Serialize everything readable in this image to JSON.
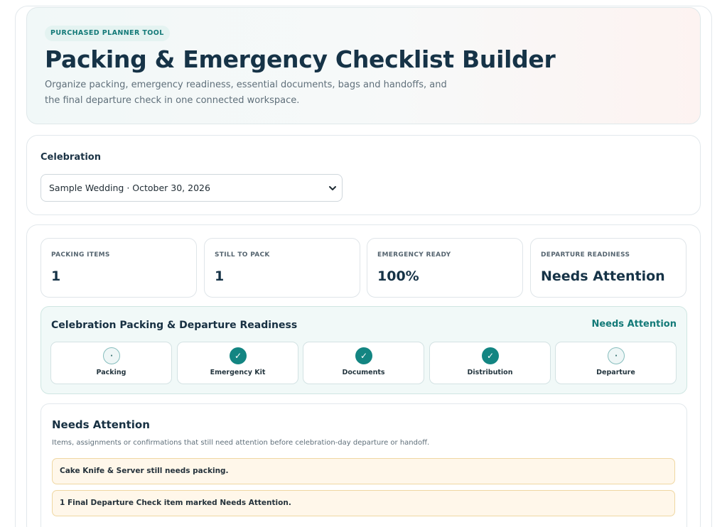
{
  "hero": {
    "badge": "PURCHASED PLANNER TOOL",
    "title": "Packing & Emergency Checklist Builder",
    "subtitle": "Organize packing, emergency readiness, essential documents, bags and handoffs, and the final departure check in one connected workspace."
  },
  "selector": {
    "label": "Celebration",
    "value": "Sample Wedding · October 30, 2026"
  },
  "stats": [
    {
      "label": "PACKING ITEMS",
      "value": "1"
    },
    {
      "label": "STILL TO PACK",
      "value": "1"
    },
    {
      "label": "EMERGENCY READY",
      "value": "100%"
    },
    {
      "label": "DEPARTURE READINESS",
      "value": "Needs Attention"
    }
  ],
  "readiness": {
    "title": "Celebration Packing & Departure Readiness",
    "status": "Needs Attention",
    "steps": [
      {
        "label": "Packing",
        "glyph": "·",
        "state": "pending"
      },
      {
        "label": "Emergency Kit",
        "glyph": "✓",
        "state": "done"
      },
      {
        "label": "Documents",
        "glyph": "✓",
        "state": "done"
      },
      {
        "label": "Distribution",
        "glyph": "✓",
        "state": "done"
      },
      {
        "label": "Departure",
        "glyph": "·",
        "state": "pending"
      }
    ]
  },
  "attention": {
    "title": "Needs Attention",
    "subtitle": "Items, assignments or confirmations that still need attention before celebration-day departure or handoff.",
    "alerts": [
      "Cake Knife & Server still needs packing.",
      "1 Final Departure Check item marked Needs Attention."
    ]
  },
  "colors": {
    "accent": "#138582",
    "title": "#163347",
    "alert_bg": "#fff7ea",
    "alert_border": "#efd7a2"
  },
  "icons": {
    "select_chevron": "chevron-down-icon",
    "step_done": "check-icon",
    "step_pending": "dot-icon"
  }
}
